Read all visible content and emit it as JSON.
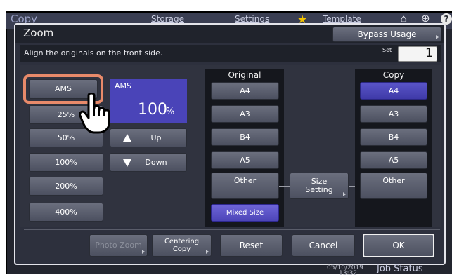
{
  "topbar": {
    "copy_label": "Copy",
    "storage_label": "Storage",
    "settings_label": "Settings",
    "template_label": "Template"
  },
  "dialog": {
    "title": "Zoom",
    "bypass_label": "Bypass Usage",
    "message": "Align the originals on the front side.",
    "set_label": "Set",
    "set_value": "1"
  },
  "zoom": {
    "presets": [
      "AMS",
      "25%",
      "50%",
      "100%",
      "200%",
      "400%"
    ],
    "display_mode": "AMS",
    "display_value": "100",
    "display_unit": "%",
    "up_label": "Up",
    "down_label": "Down"
  },
  "original": {
    "header": "Original",
    "sizes": [
      "A4",
      "A3",
      "B4",
      "A5",
      "Other"
    ],
    "mixed_label": "Mixed Size"
  },
  "size_setting_label": "Size\nSetting",
  "copy": {
    "header": "Copy",
    "sizes": [
      "A4",
      "A3",
      "B4",
      "A5",
      "Other"
    ],
    "selected": "A4"
  },
  "bottom": {
    "photo_zoom_label": "Photo Zoom",
    "centering_label": "Centering\nCopy",
    "reset_label": "Reset",
    "cancel_label": "Cancel",
    "ok_label": "OK"
  },
  "status": {
    "date_label": "05/10/2019",
    "time_label": "13:32",
    "job_status_label": "Job Status"
  },
  "colors": {
    "highlight_ring": "#e88a6a",
    "selected_button": "#4a44b8",
    "panel_bg": "#2c2f3c",
    "column_bg": "#15171d"
  }
}
